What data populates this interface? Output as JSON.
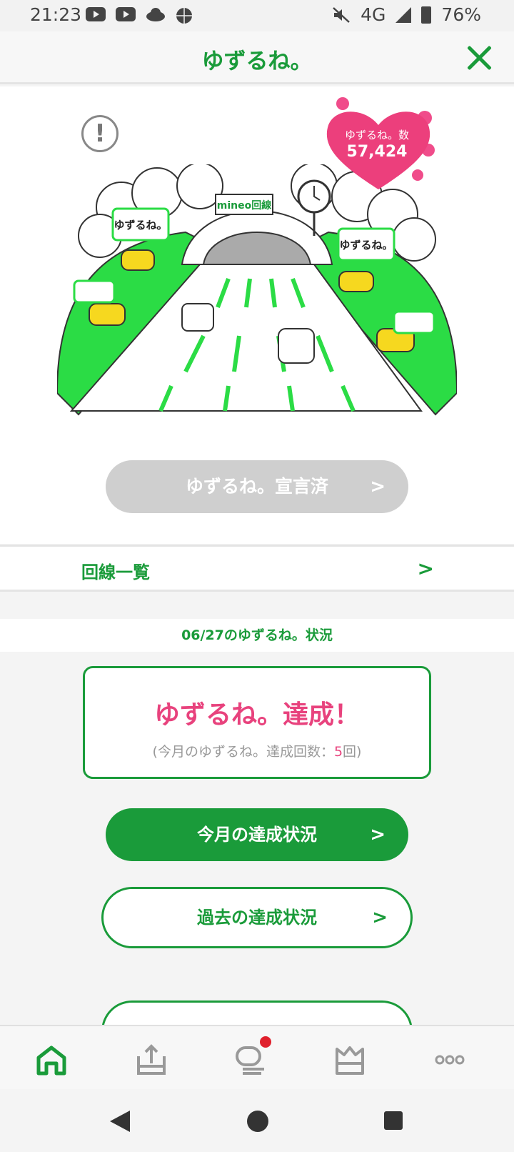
{
  "status_bar": {
    "time": "21:23",
    "network": "4G",
    "battery": "76%"
  },
  "header": {
    "title": "ゆずるね。"
  },
  "hero": {
    "heart_label": "ゆずるね。数",
    "heart_count": "57,424",
    "sign_brand": "mineo回線",
    "bubble_text": "ゆずるね。",
    "declared_button": "ゆずるね。宣言済"
  },
  "lines": {
    "label": "回線一覧"
  },
  "status": {
    "heading": "06/27のゆずるね。状況",
    "achieve_title": "ゆずるね。達成！",
    "achieve_prefix": "(今月のゆずるね。達成回数：",
    "achieve_count": "5",
    "achieve_suffix": "回)",
    "month_button": "今月の達成状況",
    "past_button": "過去の達成状況"
  },
  "bottom_nav": {
    "items": [
      "home-icon",
      "upload-icon",
      "chat-icon",
      "crown-icon",
      "more-icon"
    ],
    "active_color": "#1a9b3a"
  },
  "colors": {
    "brand": "#1a9b3a",
    "accent_pink": "#e8427d",
    "disabled": "#cfcfcf"
  }
}
